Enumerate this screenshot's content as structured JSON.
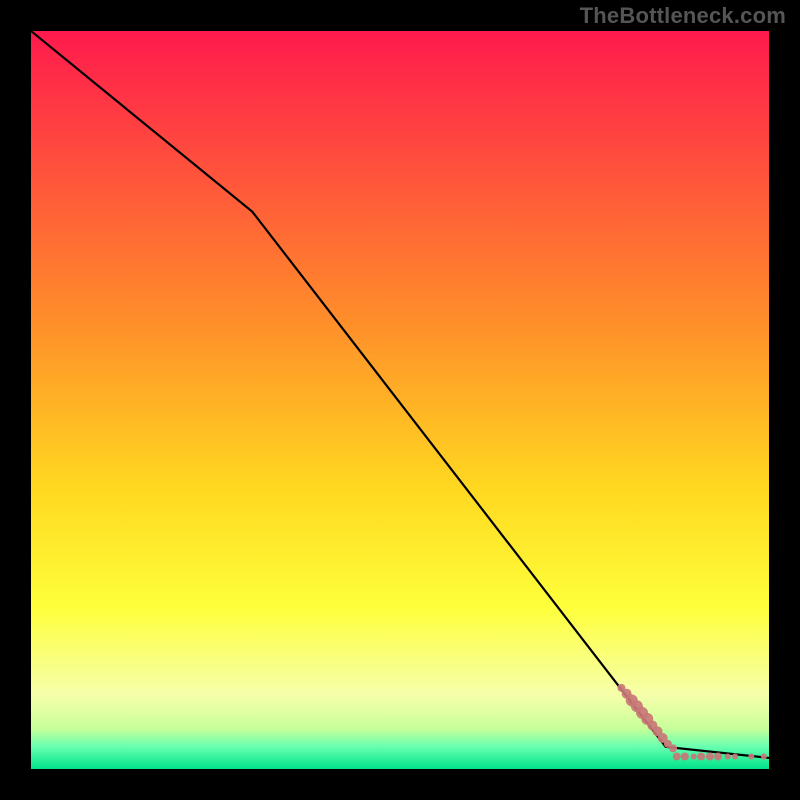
{
  "watermark": "TheBottleneck.com",
  "colors": {
    "frame": "#000000",
    "watermark": "#555555",
    "line": "#000000",
    "scatter_fill": "#c97777",
    "gradient_stops": [
      {
        "offset": 0.0,
        "color": "#ff1a4d"
      },
      {
        "offset": 0.38,
        "color": "#ff8a2b"
      },
      {
        "offset": 0.62,
        "color": "#ffd820"
      },
      {
        "offset": 0.78,
        "color": "#feff3a"
      },
      {
        "offset": 0.9,
        "color": "#f6ffab"
      },
      {
        "offset": 0.945,
        "color": "#c8ff9a"
      },
      {
        "offset": 0.97,
        "color": "#67ffb0"
      },
      {
        "offset": 1.0,
        "color": "#00e38a"
      }
    ]
  },
  "chart_data": {
    "type": "line",
    "title": "",
    "xlabel": "",
    "ylabel": "",
    "xlim": [
      0,
      100
    ],
    "ylim": [
      0,
      100
    ],
    "series": [
      {
        "name": "curve",
        "type": "line",
        "x": [
          0,
          30,
          86,
          100
        ],
        "y": [
          100,
          75.5,
          3,
          1.5
        ]
      },
      {
        "name": "diagonal-cluster",
        "type": "scatter",
        "points": [
          {
            "x": 80.0,
            "y": 11.0,
            "r": 4
          },
          {
            "x": 80.7,
            "y": 10.2,
            "r": 5
          },
          {
            "x": 81.4,
            "y": 9.3,
            "r": 6
          },
          {
            "x": 82.1,
            "y": 8.5,
            "r": 6
          },
          {
            "x": 82.8,
            "y": 7.6,
            "r": 6
          },
          {
            "x": 83.5,
            "y": 6.8,
            "r": 6
          },
          {
            "x": 84.2,
            "y": 5.9,
            "r": 5
          },
          {
            "x": 84.9,
            "y": 5.1,
            "r": 5
          },
          {
            "x": 85.6,
            "y": 4.2,
            "r": 5
          },
          {
            "x": 86.3,
            "y": 3.4,
            "r": 4
          },
          {
            "x": 87.0,
            "y": 2.8,
            "r": 4
          }
        ]
      },
      {
        "name": "bottom-cluster",
        "type": "scatter",
        "points": [
          {
            "x": 87.5,
            "y": 1.7,
            "r": 4
          },
          {
            "x": 88.6,
            "y": 1.7,
            "r": 4
          },
          {
            "x": 89.8,
            "y": 1.7,
            "r": 3
          },
          {
            "x": 90.8,
            "y": 1.7,
            "r": 4
          },
          {
            "x": 92.0,
            "y": 1.7,
            "r": 4
          },
          {
            "x": 93.1,
            "y": 1.7,
            "r": 4
          },
          {
            "x": 94.4,
            "y": 1.7,
            "r": 3
          },
          {
            "x": 95.4,
            "y": 1.7,
            "r": 3
          },
          {
            "x": 97.6,
            "y": 1.7,
            "r": 3
          },
          {
            "x": 99.3,
            "y": 1.7,
            "r": 3
          }
        ]
      }
    ]
  }
}
